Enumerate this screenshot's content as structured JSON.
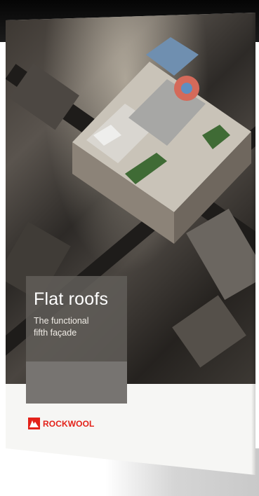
{
  "cover": {
    "title": "Flat roofs",
    "subtitle_line1": "The functional",
    "subtitle_line2": "fifth façade"
  },
  "brand": {
    "name": "ROCKWOOL",
    "logo_icon": "rockwool-logo-icon",
    "color": "#e32119"
  },
  "colors": {
    "title_box": "#605c58",
    "gray_band": "#777471",
    "background": "#ffffff"
  }
}
